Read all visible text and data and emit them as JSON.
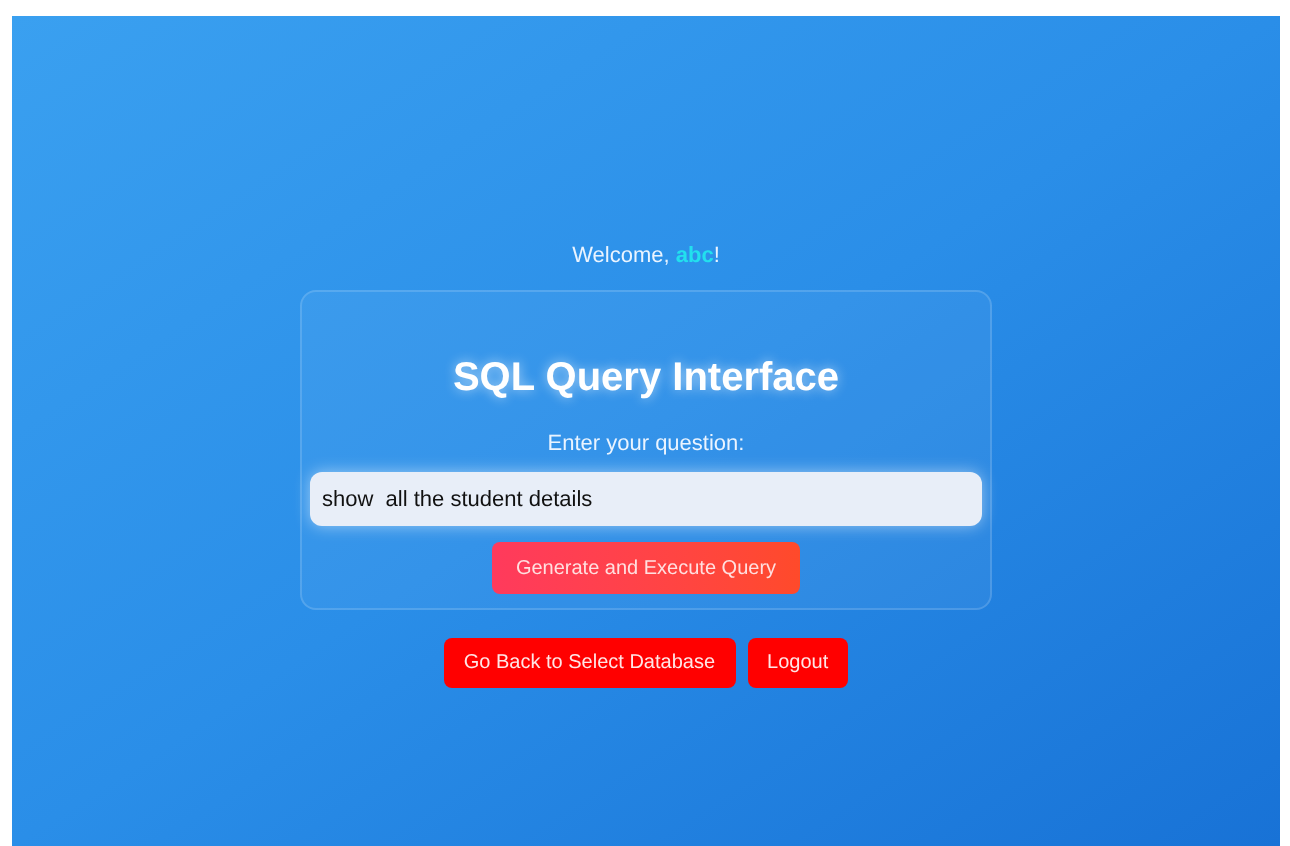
{
  "welcome": {
    "prefix": "Welcome, ",
    "username": "abc",
    "suffix": "!"
  },
  "card": {
    "title": "SQL Query Interface",
    "label": "Enter your question:",
    "question": {
      "value": "show  all the student details"
    },
    "submit": "Generate and Execute Query"
  },
  "buttons": [
    {
      "label": "Go Back to Select Database"
    },
    {
      "label": "Logout"
    }
  ]
}
